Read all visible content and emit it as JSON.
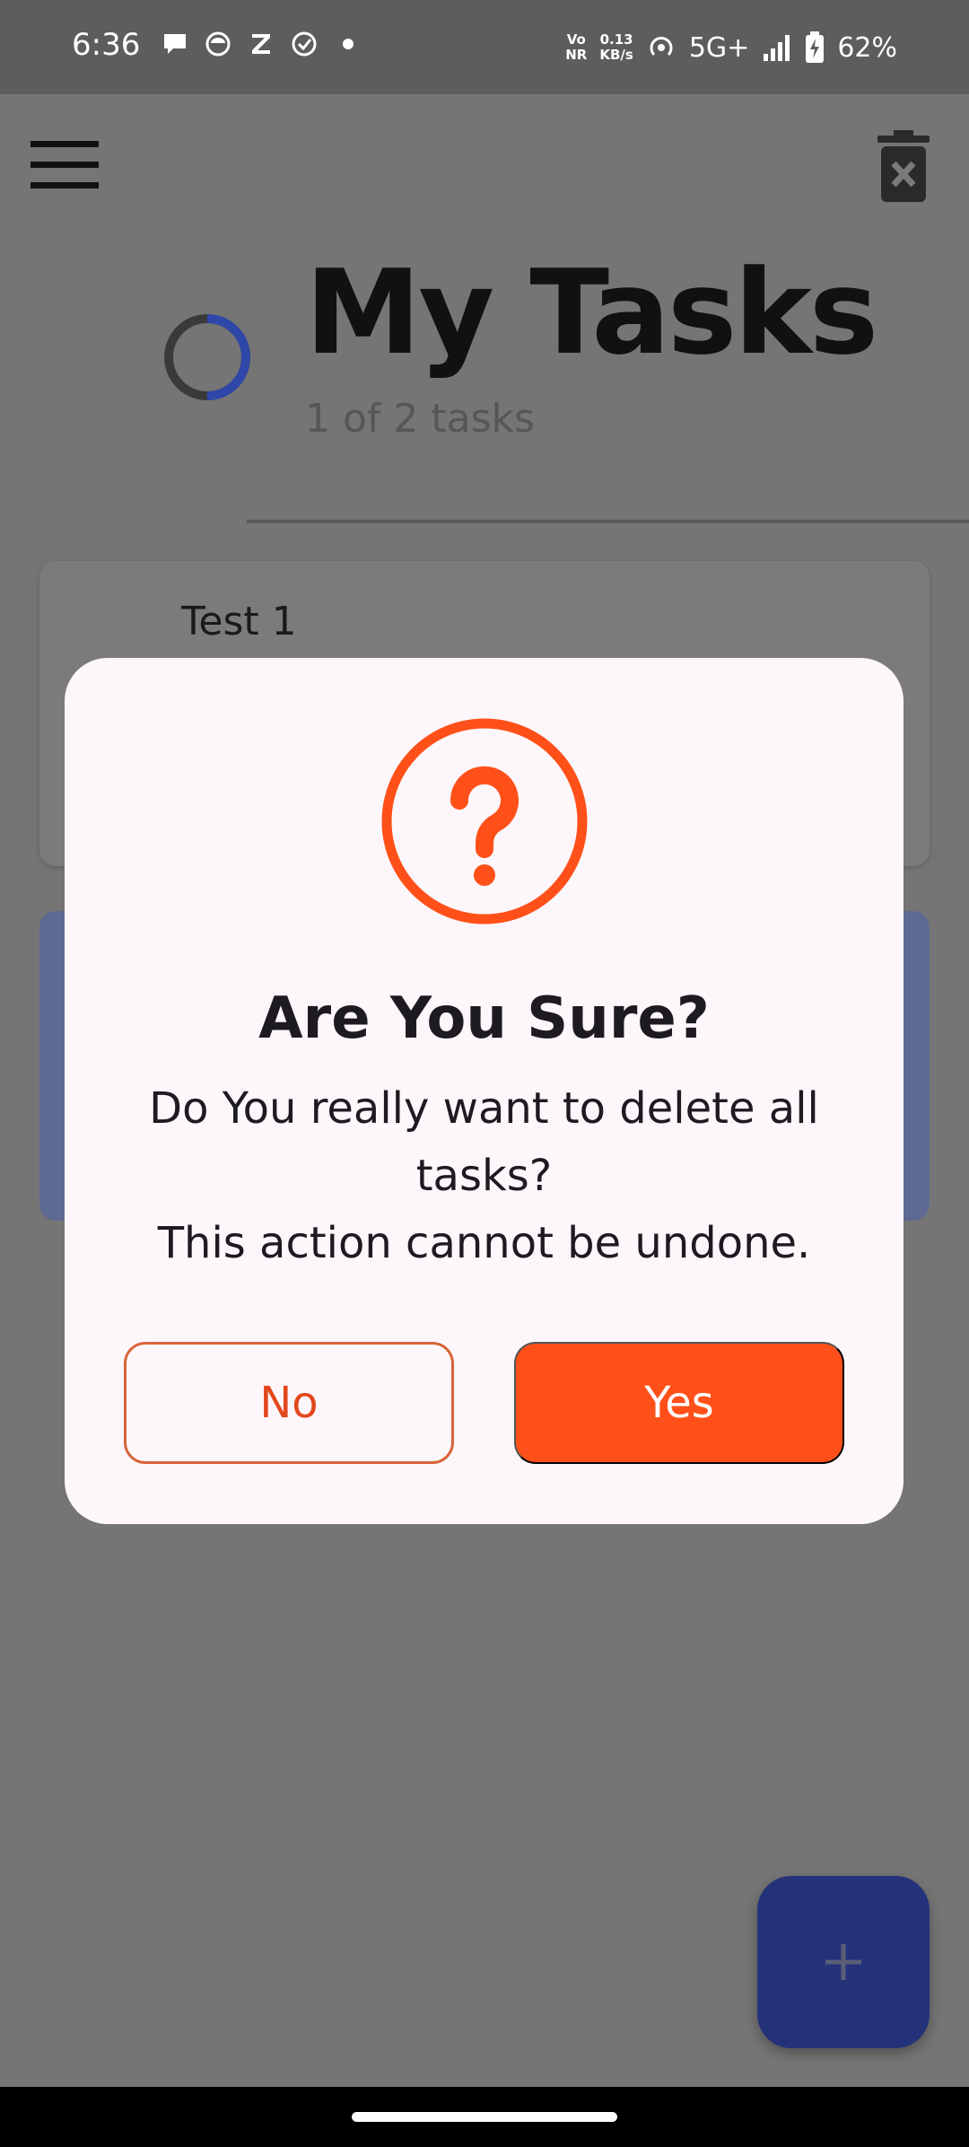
{
  "status_bar": {
    "time": "6:36",
    "notification_icons": [
      "chat-bubble-icon",
      "face-app-icon",
      "z-app-icon",
      "check-circle-icon",
      "dot-icon"
    ],
    "network_type_top": "Vo",
    "network_type_bottom": "NR",
    "speed_value": "0.13",
    "speed_unit": "KB/s",
    "network": "5G+",
    "battery": "62%"
  },
  "app": {
    "title": "My Tasks",
    "task_count": "1 of 2 tasks",
    "progress": 0.5,
    "accent_color": "#2f47a8",
    "tasks": [
      {
        "title": "Test 1"
      }
    ]
  },
  "dialog": {
    "title": "Are You Sure?",
    "message_line1": "Do You really want to delete all tasks?",
    "message_line2": "This action cannot be undone.",
    "no_label": "No",
    "yes_label": "Yes",
    "accent_color": "#ff5019"
  }
}
